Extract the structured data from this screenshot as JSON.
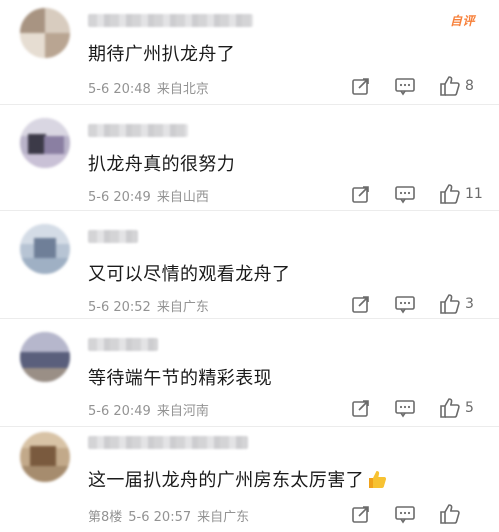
{
  "badge": "自评",
  "comments": [
    {
      "text": "期待广州扒龙舟了",
      "time": "5-6 20:48",
      "location": "来自北京",
      "likes": "8",
      "floor": ""
    },
    {
      "text": "扒龙舟真的很努力",
      "time": "5-6 20:49",
      "location": "来自山西",
      "likes": "11",
      "floor": ""
    },
    {
      "text": "又可以尽情的观看龙舟了",
      "time": "5-6 20:52",
      "location": "来自广东",
      "likes": "3",
      "floor": ""
    },
    {
      "text": "等待端午节的精彩表现",
      "time": "5-6 20:49",
      "location": "来自河南",
      "likes": "5",
      "floor": ""
    },
    {
      "text": "这一届扒龙舟的广州房东太厉害了",
      "time": "5-6 20:57",
      "location": "来自广东",
      "likes": "",
      "floor": "第8楼"
    }
  ],
  "icons": {
    "share": "share-icon",
    "reply": "comment-icon",
    "like": "thumbs-up-icon",
    "emoji": "thumbs-up-emoji"
  },
  "colors": {
    "text": "#1b1b1b",
    "meta": "#939393",
    "icon": "#6b6b6b",
    "badge": "#f7803a"
  }
}
